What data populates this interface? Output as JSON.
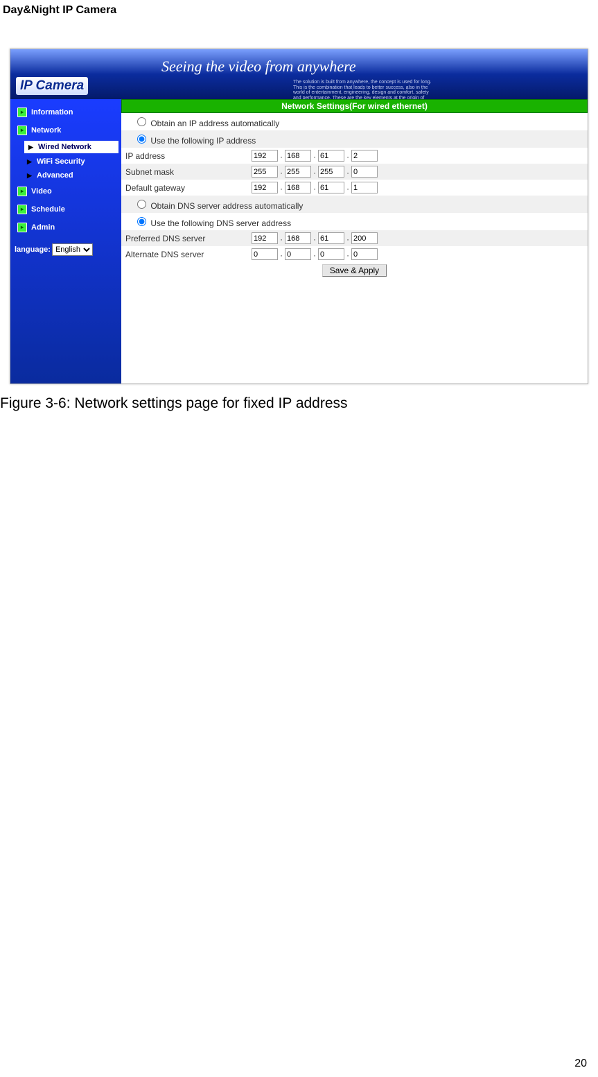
{
  "doc": {
    "title": "Day&Night IP Camera",
    "caption": "Figure 3-6: Network settings page for fixed IP address",
    "page_number": "20"
  },
  "banner": {
    "logo": "IP Camera",
    "slogan": "Seeing the video from anywhere",
    "sub": "The solution is built from anywhere,\nthe concept is used for long.\nThis is the combination that leads to better success,\nalso in the world of entertainment, engineering,\ndesign and comfort, safety and performance.\nThese are the key elements at the origin of the IP Camera."
  },
  "sidebar": {
    "items": [
      {
        "label": "Information"
      },
      {
        "label": "Network"
      },
      {
        "label": "Video"
      },
      {
        "label": "Schedule"
      },
      {
        "label": "Admin"
      }
    ],
    "network_sub": [
      {
        "label": "Wired Network",
        "active": true
      },
      {
        "label": "WiFi Security"
      },
      {
        "label": "Advanced"
      }
    ],
    "language_label": "language:",
    "language_value": "English"
  },
  "form": {
    "header": "Network Settings(For wired ethernet)",
    "obtain_ip": "Obtain an IP address automatically",
    "use_ip": "Use the following IP address",
    "ip_label": "IP address",
    "ip": [
      "192",
      "168",
      "61",
      "2"
    ],
    "subnet_label": "Subnet mask",
    "subnet": [
      "255",
      "255",
      "255",
      "0"
    ],
    "gateway_label": "Default gateway",
    "gateway": [
      "192",
      "168",
      "61",
      "1"
    ],
    "obtain_dns": "Obtain DNS server address automatically",
    "use_dns": "Use the following DNS server address",
    "pref_dns_label": "Preferred DNS server",
    "pref_dns": [
      "192",
      "168",
      "61",
      "200"
    ],
    "alt_dns_label": "Alternate DNS server",
    "alt_dns": [
      "0",
      "0",
      "0",
      "0"
    ],
    "save_label": "Save & Apply"
  }
}
